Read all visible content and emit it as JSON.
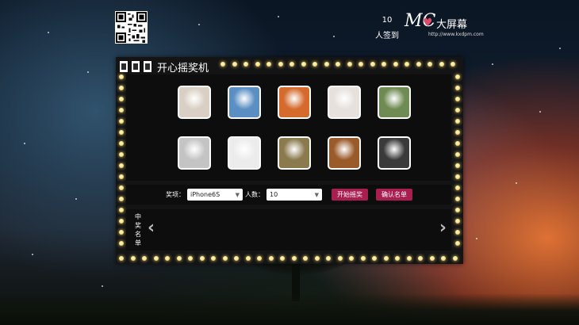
{
  "signin": {
    "count": "10",
    "label": "人签到"
  },
  "logo": {
    "mark": "MC",
    "name": "大屏幕",
    "url": "http://www.kxdpm.com"
  },
  "panel": {
    "title": "开心摇奖机"
  },
  "candidates": [
    {
      "icon": "cat-avatar",
      "color": "#d9cfc4"
    },
    {
      "icon": "anime-boy-avatar",
      "color": "#5b8fc4"
    },
    {
      "icon": "naruto-avatar",
      "color": "#d46a2c"
    },
    {
      "icon": "chibi-girl-avatar",
      "color": "#e6e1dc"
    },
    {
      "icon": "garden-avatar",
      "color": "#6f8a52"
    },
    {
      "icon": "couple-photo-avatar",
      "color": "#c4c4c4"
    },
    {
      "icon": "smirk-face-avatar",
      "color": "#ececec"
    },
    {
      "icon": "dogs-photo-avatar",
      "color": "#8a7a4e"
    },
    {
      "icon": "dog-closeup-avatar",
      "color": "#9a5a2a"
    },
    {
      "icon": "man-portrait-avatar",
      "color": "#3a3a3a"
    }
  ],
  "controls": {
    "prize_label": "奖项：",
    "prize_value": "iPhone6S",
    "people_label": "人数：",
    "people_value": "10",
    "start_button": "开始摇奖",
    "confirm_button": "确认名单"
  },
  "winners": {
    "label": "中奖名单",
    "prev_icon": "‹",
    "next_icon": "›"
  }
}
